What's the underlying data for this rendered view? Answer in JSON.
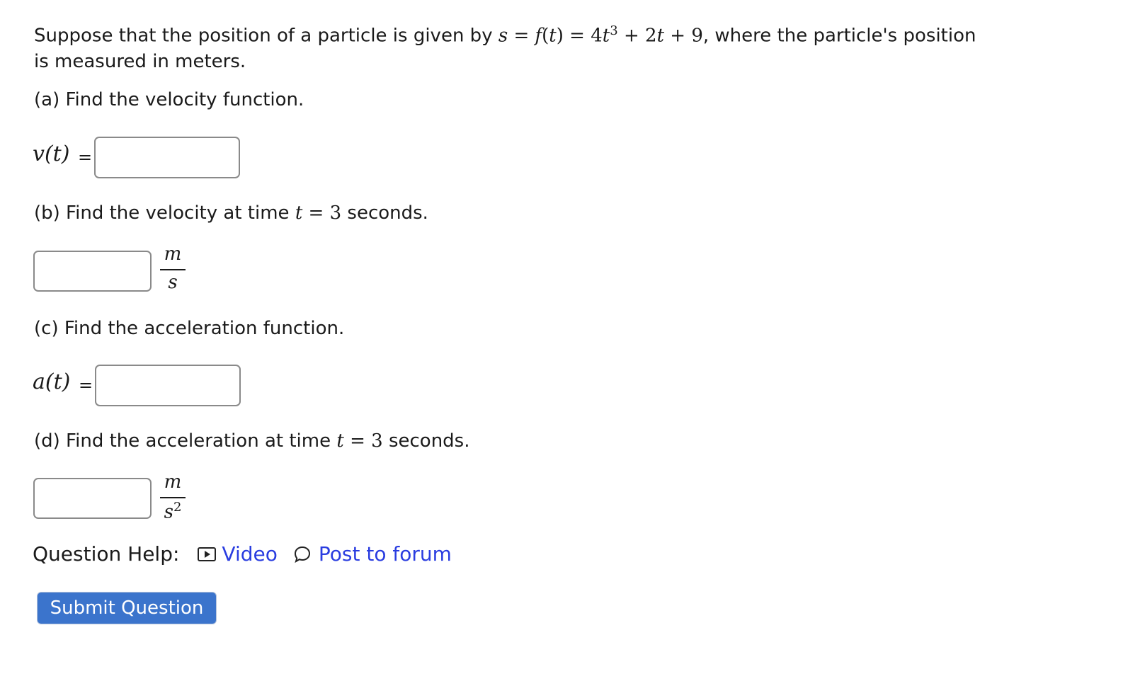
{
  "intro": {
    "text_before": "Suppose that the position of a particle is given by ",
    "formula": {
      "s": "s",
      "eq1": " = ",
      "f": "f",
      "lparen": "(",
      "t": "t",
      "rparen": ")",
      "eq2": " = ",
      "coef": "4",
      "t2": "t",
      "exp": "3",
      "rest_plus1": " + ",
      "term2_coef": "2",
      "term2_var": "t",
      "rest_plus2": " + ",
      "const": "9"
    },
    "text_after_line1": ", where the particle's position",
    "text_line2": "is measured in meters."
  },
  "parts": {
    "a": {
      "label": "(a) Find the velocity function.",
      "lhs_func": "v",
      "lhs_arg": "(t)",
      "equals": "=",
      "value": "",
      "placeholder": ""
    },
    "b": {
      "label_prefix": "(b) Find the velocity at time ",
      "var": "t",
      "equals": " = ",
      "value_time": "3",
      "label_suffix": " seconds.",
      "value": "",
      "unit_num": "m",
      "unit_den": "s",
      "unit_den_exp": ""
    },
    "c": {
      "label": "(c) Find the acceleration function.",
      "lhs_func": "a",
      "lhs_arg": "(t)",
      "equals": "=",
      "value": "",
      "placeholder": ""
    },
    "d": {
      "label_prefix": "(d) Find the acceleration at time ",
      "var": "t",
      "equals": " = ",
      "value_time": "3",
      "label_suffix": " seconds.",
      "value": "",
      "unit_num": "m",
      "unit_den": "s",
      "unit_den_exp": "2"
    }
  },
  "help": {
    "label": "Question Help:",
    "video_icon": "video-icon",
    "video_label": "Video",
    "forum_icon": "speech-bubble-icon",
    "forum_label": "Post to forum"
  },
  "submit": {
    "label": "Submit Question"
  },
  "colors": {
    "link": "#2a3de0",
    "button_bg": "#3b74cc",
    "input_border": "#8a8a8a"
  }
}
